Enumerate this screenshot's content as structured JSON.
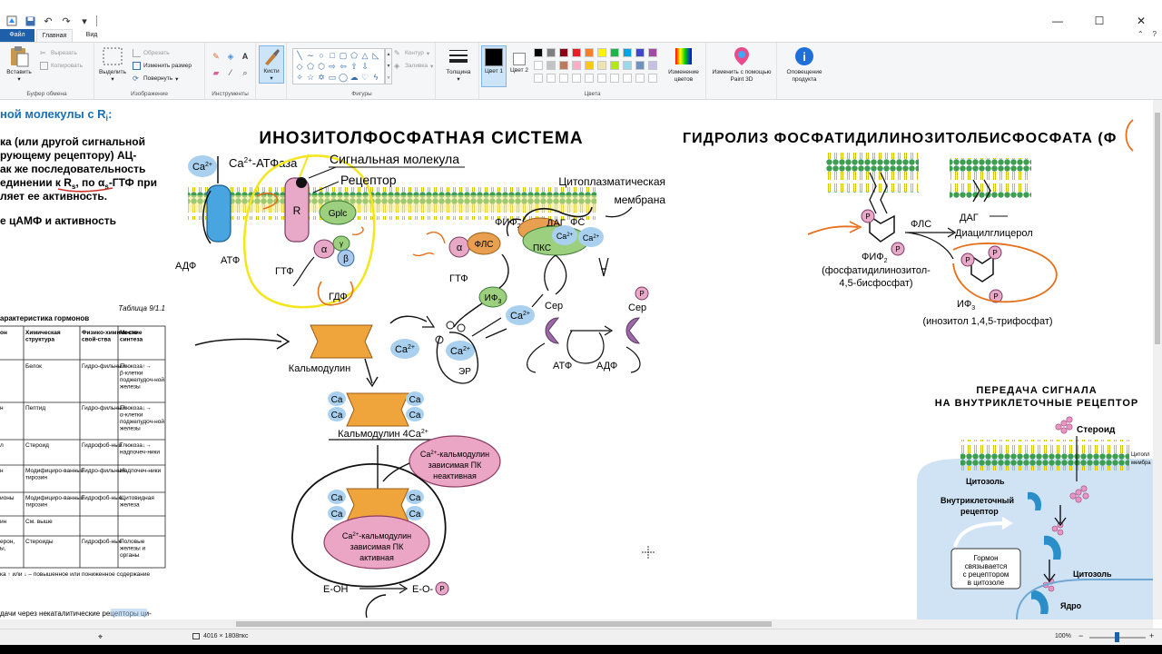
{
  "window": {
    "minimize_glyph": "—",
    "maximize_glyph": "☐",
    "close_glyph": "✕"
  },
  "tabs": [
    "Файл",
    "Главная",
    "Вид"
  ],
  "ribbon": {
    "clipboard": {
      "paste": "Вставить",
      "cut": "Вырезать",
      "copy": "Копировать",
      "label": "Буфер обмена"
    },
    "image": {
      "select": "Выделить",
      "crop": "Обрезать",
      "resize": "Изменить размер",
      "rotate": "Повернуть",
      "label": "Изображение"
    },
    "tools": {
      "label": "Инструменты"
    },
    "brushes": {
      "label": "Кисти"
    },
    "shapes": {
      "outline": "Контур",
      "fill": "Заливка",
      "label": "Фигуры"
    },
    "size": {
      "label": "Толщина"
    },
    "colors": {
      "color1": "Цвет 1",
      "color2": "Цвет 2",
      "edit": "Изменение цветов",
      "label": "Цвета",
      "swatches_row1": [
        "#000000",
        "#7f7f7f",
        "#880015",
        "#ed1c24",
        "#ff7f27",
        "#fff200",
        "#22b14c",
        "#00a2e8",
        "#3f48cc",
        "#a349a4"
      ],
      "swatches_row2": [
        "#ffffff",
        "#c3c3c3",
        "#b97a57",
        "#ffaec9",
        "#ffc90e",
        "#efe4b0",
        "#b5e61d",
        "#99d9ea",
        "#7092be",
        "#c8bfe7"
      ]
    },
    "paint3d": "Изменить с помощью Paint 3D",
    "alert": "Оповещение продукта"
  },
  "document": {
    "left_header": "ной молекулы с R",
    "left_header_sub": "i",
    "left_lines": [
      "ка (или другой сигнальной",
      "рующему рецептору) АЦ-",
      "ак же последовательность",
      "единении к R",
      "ляет ее активность.",
      "е цАМФ и активность"
    ],
    "left_line4_tail": ", по α",
    "left_line4_gtf": "-ГТФ при",
    "table_caption": "Таблица 9/1.1",
    "table_title": "арактеристика гормонов",
    "table_headers": [
      "он",
      "Химическая структура",
      "Физико-химиче-ские свой-ства",
      "Место синтеза"
    ],
    "table_rows": [
      [
        "",
        "Белок",
        "Гидро-фильный",
        "Глюкоза↑→ β-клетки поджелудоч-ной железы"
      ],
      [
        "н",
        "Пептид",
        "Гидро-фильный",
        "Глюкоза↓→ α-клетки поджелудоч-ной железы"
      ],
      [
        "л",
        "Стероид",
        "Гидрофоб-ный",
        "Глюкоза↓→ надпочеч-ники"
      ],
      [
        "н",
        "Модифициро-ванный тирозин",
        "Гидро-фильный",
        "Надпочеч-ники"
      ],
      [
        "ионы",
        "Модифициро-ванный тирозин",
        "Гидрофоб-ные",
        "Щитовидная железа"
      ],
      [
        "ин",
        "См. выше",
        "",
        ""
      ],
      [
        "ерон, ы,",
        "Стероиды",
        "Гидрофоб-ные",
        "Половые железы и органы"
      ]
    ],
    "table_note": "ка ↑ или ↓ – повышенное или пониженное содержание",
    "bottom_note": "дачи через некаталитические рецепторы ци-",
    "main_title": "ИНОЗИТОЛФОСФАТНАЯ СИСТЕМА",
    "hydro_title": "ГИДРОЛИЗ ФОСФАТИДИЛИНОЗИТОЛБИСФОСФАТА (Ф",
    "signal_title_1": "ПЕРЕДАЧА СИГНАЛА",
    "signal_title_2": "НА ВНУТРИКЛЕТОЧНЫЕ РЕЦЕПТОР",
    "labels": {
      "ca2": "Ca",
      "sup2": "2+",
      "ca_atpase": "-АТФаза",
      "signal_molecule": "Сигнальная молекула",
      "receptor": "Рецептор",
      "cytoplasmic": "Цитоплазматическая",
      "membrane": "мембрана",
      "R": "R",
      "gplc": "Gplc",
      "alpha": "α",
      "beta": "β",
      "gamma": "γ",
      "adf": "АДФ",
      "atf": "АТФ",
      "gtf": "ГТФ",
      "gdf": "ГДФ",
      "fls": "ФЛС",
      "fif2": "ФИФ",
      "dag": "ДАГ",
      "fs": "ФС",
      "pks": "ПКС",
      "if3": "ИФ",
      "er": "ЭР",
      "ser": "Сер",
      "P": "P",
      "calmodulin": "Кальмодулин",
      "calmodulin4": "Кальмодулин 4Ca",
      "ca_short": "Ca",
      "cam_pk": "-кальмодулин",
      "dependent_pk": "зависимая ПК",
      "inactive": "неактивная",
      "active": "активная",
      "eoh": "E-OH",
      "eop": "E-O-",
      "fls_right": "ФЛС",
      "dag_right": "ДАГ",
      "diacylglycerol": "Диацилглицерол",
      "fif2_full": "(фосфатидилинозитол-",
      "fif2_full2": "4,5-бисфосфат)",
      "if3_full": "(инозитол 1,4,5-трифосфат)",
      "steroid": "Стероид",
      "cytosol": "Цитозоль",
      "intracellular": "Внутриклеточный",
      "receptor_lc": "рецептор",
      "hormone1": "Гормон",
      "hormone2": "связывается",
      "hormone3": "с рецептором",
      "hormone4": "в цитозоле",
      "cytosol2": "Цитозоль",
      "nucleus": "Ядро",
      "cyto_mem1": "Цитопл",
      "cyto_mem2": "мембра"
    }
  },
  "status": {
    "size": "4016 × 1808пкс",
    "zoom": "100%"
  }
}
